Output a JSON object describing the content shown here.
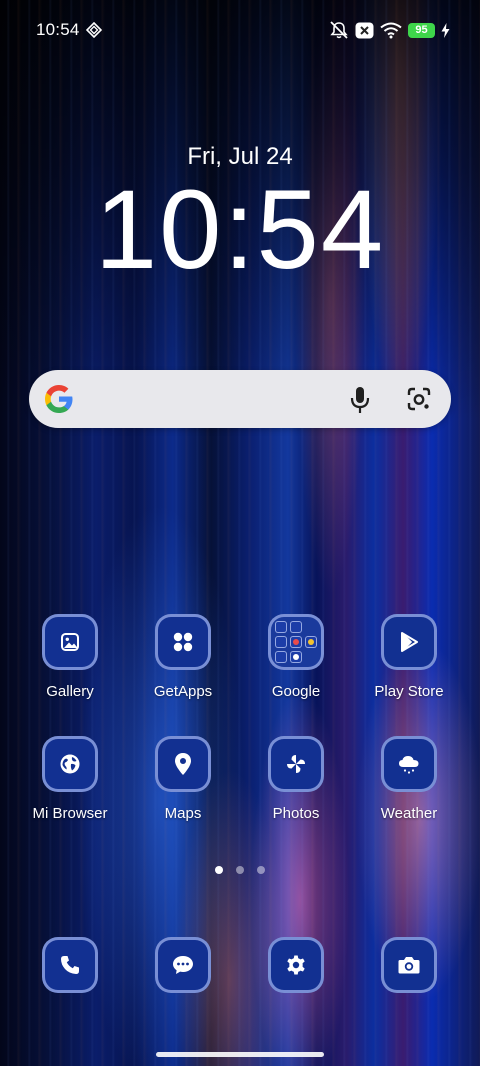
{
  "status_bar": {
    "time": "10:54",
    "battery": "95",
    "left_icon": "vpn-diamond-icon",
    "right_icons": [
      "mute-icon",
      "no-sim-icon",
      "wifi-icon",
      "battery-icon",
      "charging-icon"
    ]
  },
  "lock_clock": {
    "date": "Fri, Jul 24",
    "time": "10:54"
  },
  "search_bar": {
    "icons": [
      "google-logo-icon",
      "microphone-icon",
      "google-lens-icon"
    ]
  },
  "apps": [
    {
      "label": "Gallery",
      "icon": "gallery-icon"
    },
    {
      "label": "GetApps",
      "icon": "getapps-icon"
    },
    {
      "label": "Google",
      "icon": "folder-icon"
    },
    {
      "label": "Play Store",
      "icon": "play-store-icon"
    },
    {
      "label": "Mi Browser",
      "icon": "globe-icon"
    },
    {
      "label": "Maps",
      "icon": "map-pin-icon"
    },
    {
      "label": "Photos",
      "icon": "pinwheel-icon"
    },
    {
      "label": "Weather",
      "icon": "weather-cloud-icon"
    }
  ],
  "page_indicator": {
    "pages": 3,
    "active": 1
  },
  "dock": [
    {
      "name": "Phone",
      "icon": "phone-icon"
    },
    {
      "name": "Messages",
      "icon": "message-icon"
    },
    {
      "name": "Settings",
      "icon": "settings-gear-icon"
    },
    {
      "name": "Camera",
      "icon": "camera-icon"
    }
  ],
  "colors": {
    "icon_background": "#123091",
    "icon_border": "#8ca0e1",
    "battery_green": "#3ed64a",
    "search_bar_background": "#e8e8ec"
  }
}
